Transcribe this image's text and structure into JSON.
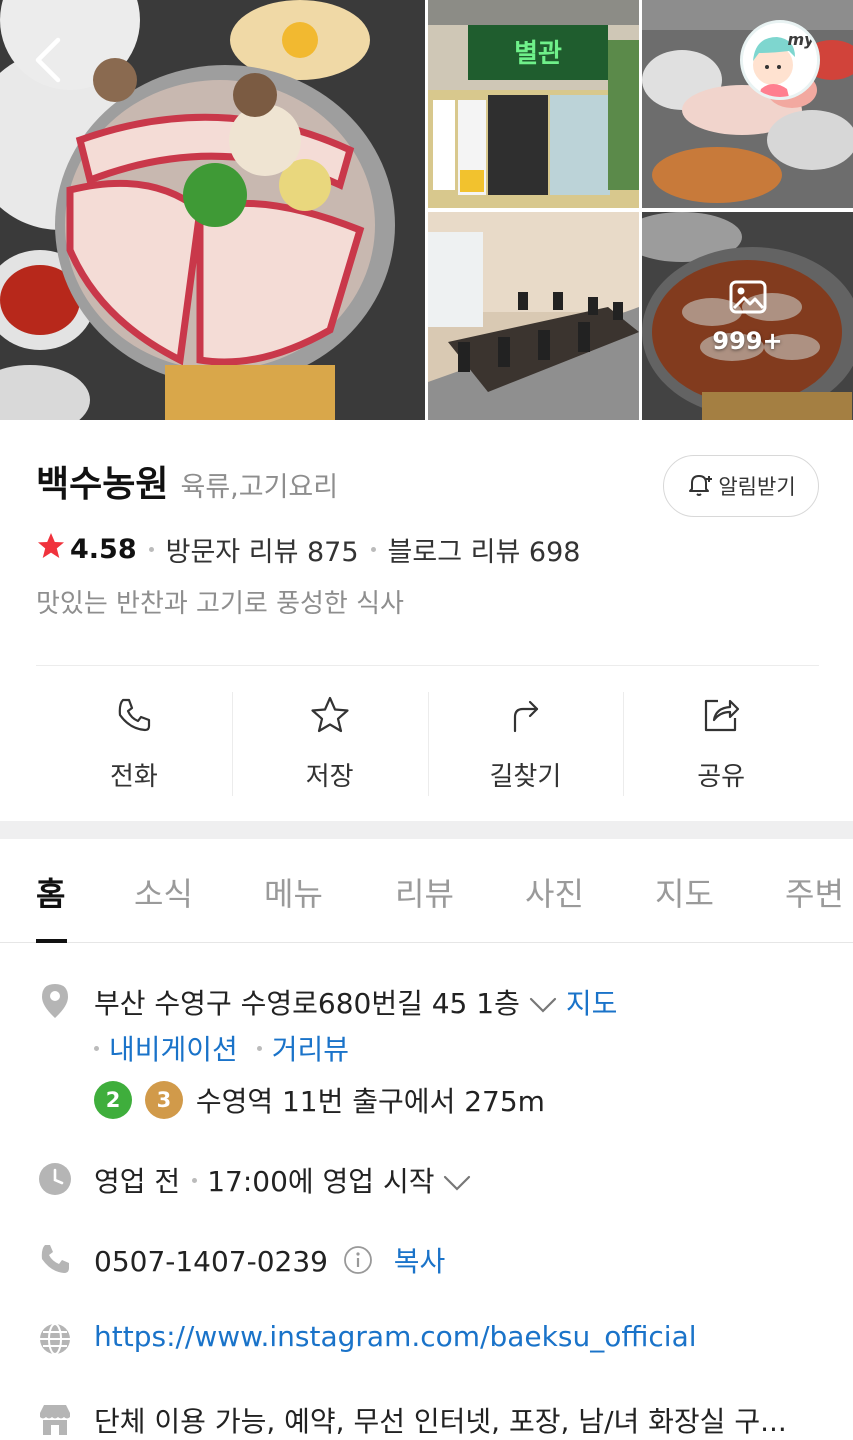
{
  "place": {
    "name": "백수농원",
    "category": "육류,고기요리",
    "rating": "4.58",
    "visitor_reviews": "방문자 리뷰 875",
    "blog_reviews": "블로그 리뷰 698",
    "description": "맛있는 반찬과 고기로 풍성한 식사",
    "alarm_label": "알림받기"
  },
  "photos": {
    "more_count": "999+",
    "sign_text": "별관",
    "avatar_text": "my"
  },
  "actions": [
    {
      "label": "전화",
      "icon": "phone-icon"
    },
    {
      "label": "저장",
      "icon": "star-icon"
    },
    {
      "label": "길찾기",
      "icon": "directions-icon"
    },
    {
      "label": "공유",
      "icon": "share-icon"
    }
  ],
  "tabs": [
    {
      "label": "홈",
      "active": true
    },
    {
      "label": "소식"
    },
    {
      "label": "메뉴"
    },
    {
      "label": "리뷰"
    },
    {
      "label": "사진"
    },
    {
      "label": "지도"
    },
    {
      "label": "주변"
    }
  ],
  "details": {
    "address": "부산 수영구 수영로680번길 45 1층",
    "map_link": "지도",
    "navigation_link": "내비게이션",
    "streetview_link": "거리뷰",
    "subway_lines": [
      "2",
      "3"
    ],
    "subway_text": "수영역 11번 출구에서 275m",
    "hours_status": "영업 전",
    "hours_text": "17:00에 영업 시작",
    "phone": "0507-1407-0239",
    "copy_label": "복사",
    "website": "https://www.instagram.com/baeksu_official",
    "amenities": "단체 이용 가능, 예약, 무선 인터넷, 포장, 남/녀 화장실 구..."
  },
  "colors": {
    "link": "#1a73c9",
    "star": "#f0323c",
    "line2": "#3fae3c",
    "line3": "#d19a4a"
  }
}
